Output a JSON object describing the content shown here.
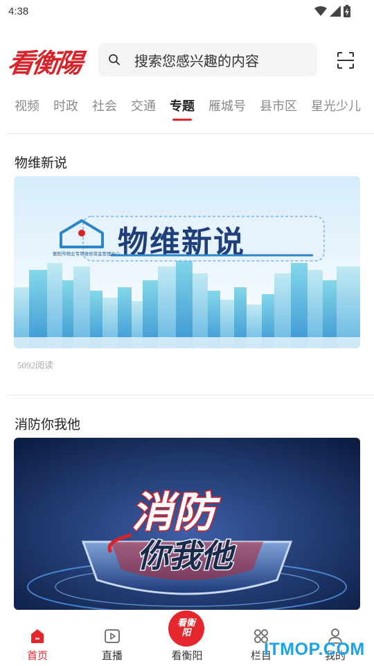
{
  "status_bar": {
    "time": "4:38",
    "icons": [
      "wifi-icon",
      "signal-icon",
      "battery-charging-icon"
    ]
  },
  "header": {
    "logo_text": "看衡陽",
    "search_placeholder": "搜索您感兴趣的内容",
    "search_icon": "search-icon",
    "scan_icon": "scan-icon"
  },
  "tabs": [
    {
      "label": "视频",
      "active": false
    },
    {
      "label": "时政",
      "active": false
    },
    {
      "label": "社会",
      "active": false
    },
    {
      "label": "交通",
      "active": false
    },
    {
      "label": "专题",
      "active": true
    },
    {
      "label": "雁城号",
      "active": false
    },
    {
      "label": "县市区",
      "active": false
    },
    {
      "label": "星光少儿",
      "active": false
    }
  ],
  "feed": [
    {
      "title": "物维新说",
      "image_text": "物维新说",
      "image_caption": "衡阳市物业专项维修资金管理中心",
      "read_count": "5092阅读"
    },
    {
      "title": "消防你我他",
      "image_text_top": "消防",
      "image_text_bottom": "你我他"
    }
  ],
  "bottom_nav": {
    "items": [
      {
        "label": "首页",
        "icon": "home-icon",
        "active": true
      },
      {
        "label": "直播",
        "icon": "play-icon",
        "active": false
      },
      {
        "label": "看衡阳",
        "icon": "brand-logo-icon",
        "active": false,
        "center_text": "看衡阳"
      },
      {
        "label": "栏目",
        "icon": "grid-icon",
        "active": false
      },
      {
        "label": "我的",
        "icon": "user-icon",
        "active": false
      }
    ]
  },
  "watermark": "ITMOP.COM",
  "colors": {
    "accent": "#e5262d",
    "text_primary": "#222222",
    "text_secondary": "#8a8a8a",
    "watermark": "#1aa3e8"
  }
}
